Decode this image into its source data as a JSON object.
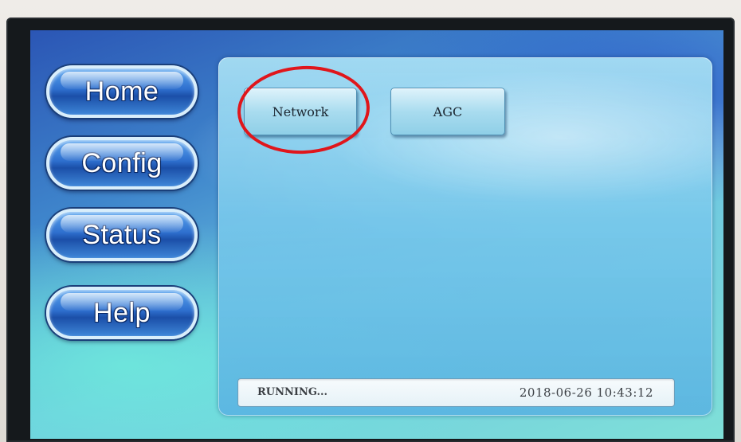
{
  "nav": {
    "items": [
      {
        "label": "Home"
      },
      {
        "label": "Config"
      },
      {
        "label": "Status"
      },
      {
        "label": "Help"
      }
    ]
  },
  "config_menu": {
    "buttons": [
      {
        "label": "Network"
      },
      {
        "label": "AGC"
      }
    ]
  },
  "status_bar": {
    "status": "RUNNING...",
    "datetime": "2018-06-26 10:43:12"
  },
  "colors": {
    "highlight": "#e0161b",
    "nav_button": "#2e6fce",
    "screen_background": "#3f86cc"
  }
}
